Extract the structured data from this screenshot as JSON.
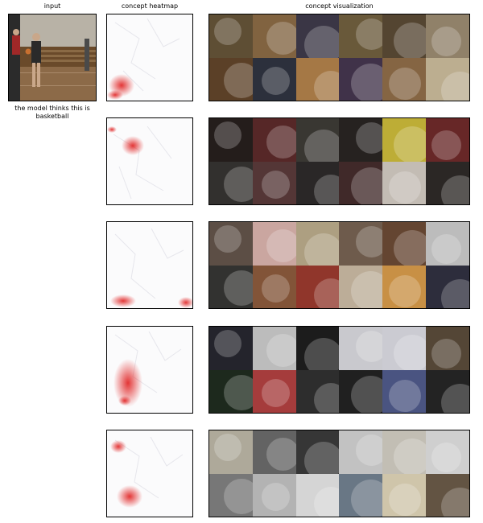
{
  "columns": {
    "input": "input",
    "heatmap": "concept heatmap",
    "visualization": "concept visualization"
  },
  "caption": "the model thinks this is basketball",
  "rows": [
    {
      "tiles": [
        "#6d5b3c",
        "#8a6a45",
        "#3e3a4a",
        "#7a6744",
        "#5a4a35",
        "#9a8a70",
        "#6a4a2e",
        "#2f3340",
        "#b0804a",
        "#4a3a55",
        "#8e6c48",
        "#c8b99a"
      ]
    },
    {
      "tiles": [
        "#2a2220",
        "#5c2a2a",
        "#3d3b36",
        "#2c2825",
        "#c9b83a",
        "#6e2a2a",
        "#3a3836",
        "#5a3a3a",
        "#2d2a2a",
        "#4a3030",
        "#d0c8c0",
        "#2e2a28"
      ]
    },
    {
      "tiles": [
        "#6b5a50",
        "#d7b1ab",
        "#b8a98a",
        "#7f6a58",
        "#6b4a35",
        "#c8c8c8",
        "#3a3a38",
        "#8b5a3c",
        "#9a3a2e",
        "#d9c8b0",
        "#d59a4a",
        "#303040"
      ]
    },
    {
      "tiles": [
        "#2a2a33",
        "#c8c8c8",
        "#1e1e1e",
        "#e8e8ee",
        "#d8d8e0",
        "#5a4b3a",
        "#223022",
        "#b04040",
        "#303030",
        "#252525",
        "#4f5a8a",
        "#262626"
      ]
    },
    {
      "tiles": [
        "#c9c3b2",
        "#6a6a6a",
        "#3a3a3a",
        "#e0e0e0",
        "#cfcac0",
        "#dcdcdc",
        "#8a8a8a",
        "#bfbfbf",
        "#e3e3e3",
        "#7a8a9a",
        "#dcd2b5",
        "#6a5a48"
      ]
    }
  ]
}
